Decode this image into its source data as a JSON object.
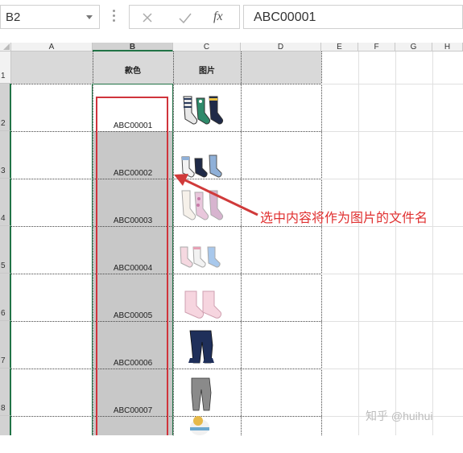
{
  "formula_bar": {
    "name_box": "B2",
    "cancel_icon": "close-icon",
    "enter_icon": "check-icon",
    "function_label": "fx",
    "content": "ABC00001"
  },
  "columns": [
    "A",
    "B",
    "C",
    "D",
    "E",
    "F",
    "G",
    "H"
  ],
  "rows": [
    "1",
    "2",
    "3",
    "4",
    "5",
    "6",
    "7",
    "8"
  ],
  "headers": {
    "style": "款色",
    "image": "图片"
  },
  "style_codes": [
    "ABC00001",
    "ABC00002",
    "ABC00003",
    "ABC00004",
    "ABC00005",
    "ABC00006",
    "ABC00007"
  ],
  "images": [
    "socks-3-pairs-striped",
    "socks-3-pairs-blue",
    "socks-3-pairs-pink-floral",
    "socks-3-pairs-pastel",
    "socks-2-pairs-pink",
    "leggings-navy",
    "leggings-gray",
    "knit-hat"
  ],
  "annotation": {
    "text": "选中内容将作为图片的文件名",
    "color": "#e03030"
  },
  "watermark": "知乎 @huihui",
  "colors": {
    "selection_border": "#217346",
    "highlight_box": "#d0343c",
    "range_fill": "#c8c8c8"
  }
}
